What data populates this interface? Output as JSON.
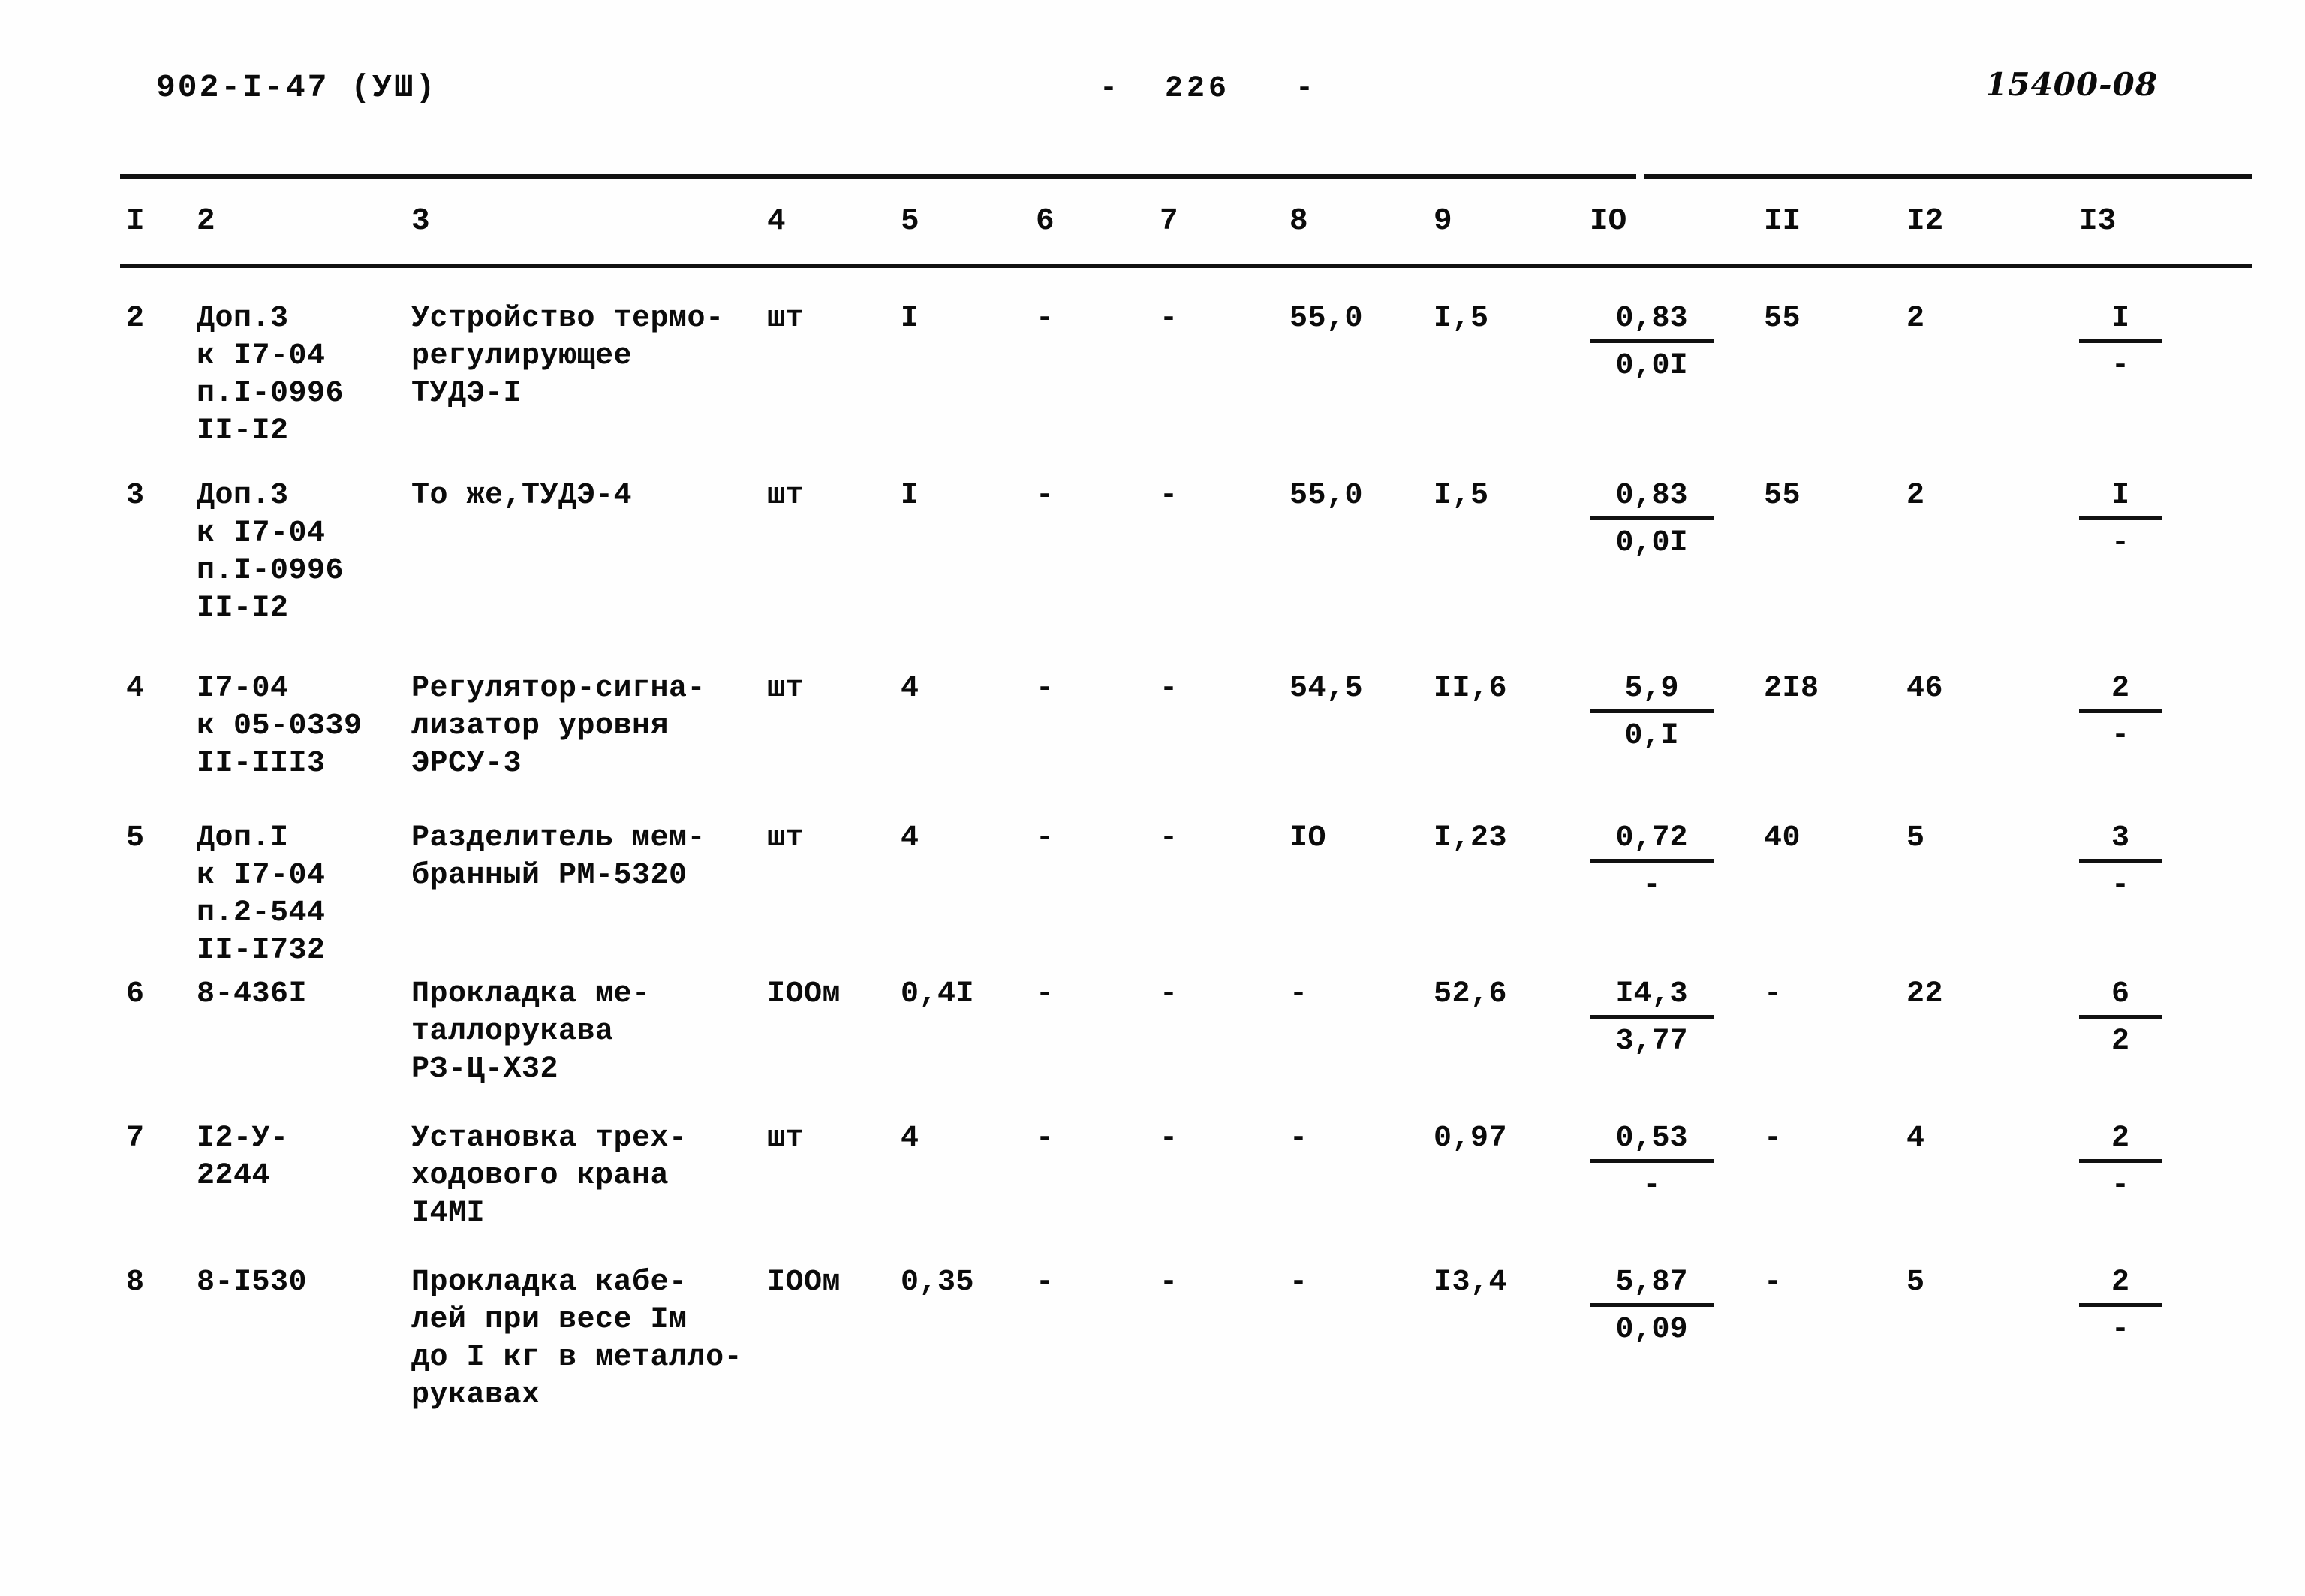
{
  "header": {
    "left_code": "902-I-47 (УШ)",
    "page_marker": "-  226   -",
    "right_code": "15400-08"
  },
  "table": {
    "column_headers": [
      "I",
      "2",
      "3",
      "4",
      "5",
      "6",
      "7",
      "8",
      "9",
      "IO",
      "II",
      "I2",
      "I3"
    ],
    "rows": [
      {
        "c1": "2",
        "c2": "Доп.3\nк I7-04\nп.I-0996\nII-I2",
        "c3": "Устройство термо-\nрегулирующее\nТУДЭ-I",
        "c4": "шт",
        "c5": "I",
        "c6": "-",
        "c7": "-",
        "c8": "55,0",
        "c9": "I,5",
        "c10_num": "0,83",
        "c10_den": "0,0I",
        "c11": "55",
        "c12": "2",
        "c13_num": "I",
        "c13_den": "-"
      },
      {
        "c1": "3",
        "c2": "Доп.3\nк I7-04\nп.I-0996\nII-I2",
        "c3": "То же,ТУДЭ-4",
        "c4": "шт",
        "c5": "I",
        "c6": "-",
        "c7": "-",
        "c8": "55,0",
        "c9": "I,5",
        "c10_num": "0,83",
        "c10_den": "0,0I",
        "c11": "55",
        "c12": "2",
        "c13_num": "I",
        "c13_den": "-"
      },
      {
        "c1": "4",
        "c2": "I7-04\nк 05-0339\nII-III3",
        "c3": "Регулятор-сигна-\nлизатор уровня\nЭРСУ-3",
        "c4": "шт",
        "c5": "4",
        "c6": "-",
        "c7": "-",
        "c8": "54,5",
        "c9": "II,6",
        "c10_num": "5,9",
        "c10_den": "0,I",
        "c11": "2I8",
        "c12": "46",
        "c13_num": "2",
        "c13_den": "-"
      },
      {
        "c1": "5",
        "c2": "Доп.I\nк I7-04\nп.2-544\nII-I732",
        "c3": "Разделитель мем-\nбранный РМ-5320",
        "c4": "шт",
        "c5": "4",
        "c6": "-",
        "c7": "-",
        "c8": "IO",
        "c9": "I,23",
        "c10_num": "0,72",
        "c10_den": "-",
        "c11": "40",
        "c12": "5",
        "c13_num": "3",
        "c13_den": "-"
      },
      {
        "c1": "6",
        "c2": "8-436I",
        "c3": "Прокладка ме-\nталлорукава\nРЗ-Ц-Х32",
        "c4": "IOOм",
        "c5": "0,4I",
        "c6": "-",
        "c7": "-",
        "c8": "-",
        "c9": "52,6",
        "c10_num": "I4,3",
        "c10_den": "3,77",
        "c11": "-",
        "c12": "22",
        "c13_num": "6",
        "c13_den": "2"
      },
      {
        "c1": "7",
        "c2": "I2-У-\n2244",
        "c3": "Установка трех-\nходового крана\nI4МI",
        "c4": "шт",
        "c5": "4",
        "c6": "-",
        "c7": "-",
        "c8": "-",
        "c9": "0,97",
        "c10_num": "0,53",
        "c10_den": "-",
        "c11": "-",
        "c12": "4",
        "c13_num": "2",
        "c13_den": "-"
      },
      {
        "c1": "8",
        "c2": "8-I530",
        "c3": "Прокладка кабе-\nлей при весе Iм\nдо I кг в металло-\nрукавах",
        "c4": "IOOм",
        "c5": "0,35",
        "c6": "-",
        "c7": "-",
        "c8": "-",
        "c9": "I3,4",
        "c10_num": "5,87",
        "c10_den": "0,09",
        "c11": "-",
        "c12": "5",
        "c13_num": "2",
        "c13_den": "-"
      }
    ]
  },
  "layout": {
    "col_header_x": [
      168,
      262,
      548,
      1022,
      1200,
      1380,
      1545,
      1718,
      1910,
      2118,
      2350,
      2540,
      2770
    ],
    "row_tops": [
      400,
      636,
      893,
      1092,
      1300,
      1492,
      1684
    ]
  }
}
